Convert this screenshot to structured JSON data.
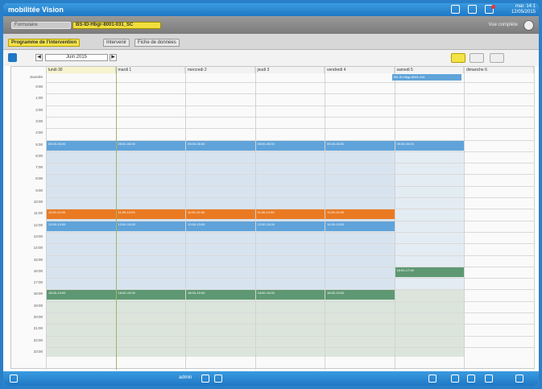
{
  "app": {
    "title": "mobilitée Vision",
    "clock_time": "mar. 14:1",
    "clock_date": "12/05/2015"
  },
  "toolbar": {
    "crumb1": "Formulaire",
    "crumb2": "BS-ID-Hbgr-8001-031_SC",
    "user": "Vue complète"
  },
  "tabs": [
    {
      "label": "Programme de l'intervention"
    },
    {
      "label": "Intervenir"
    },
    {
      "label": "Fiche de données"
    }
  ],
  "nav": {
    "date": "Juin 2015",
    "prev": "◀",
    "next": "▶"
  },
  "calendar": {
    "days": [
      "lundi 30",
      "mardi 1",
      "mercredi 2",
      "jeudi 3",
      "vendredi 4",
      "samedi 5",
      "dimanche 6"
    ],
    "allday_label": "Journée",
    "allday_event": "BS-ID-Hbgr-8001-031",
    "hours": [
      "0:00",
      "1:00",
      "2:00",
      "3:00",
      "4:00",
      "5:00",
      "6:00",
      "7:00",
      "8:00",
      "9:00",
      "10:00",
      "11:00",
      "12:00",
      "13:00",
      "14:00",
      "15:00",
      "16:00",
      "17:00",
      "18:00",
      "19:00",
      "20:00",
      "21:00",
      "22:00",
      "23:00"
    ],
    "events": [
      {
        "day": 0,
        "hour": 5,
        "color": "blue",
        "label": "05:00-06:00"
      },
      {
        "day": 1,
        "hour": 5,
        "color": "blue",
        "label": "05:00-06:00"
      },
      {
        "day": 2,
        "hour": 5,
        "color": "blue",
        "label": "05:00-06:00"
      },
      {
        "day": 3,
        "hour": 5,
        "color": "blue",
        "label": "05:00-06:00"
      },
      {
        "day": 4,
        "hour": 5,
        "color": "blue",
        "label": "05:00-06:00"
      },
      {
        "day": 5,
        "hour": 5,
        "color": "blue",
        "label": "05:00-06:00"
      },
      {
        "day": 0,
        "hour": 11,
        "color": "orange",
        "label": "11:00-12:00"
      },
      {
        "day": 1,
        "hour": 11,
        "color": "orange",
        "label": "11:00-12:00"
      },
      {
        "day": 2,
        "hour": 11,
        "color": "orange",
        "label": "11:00-12:00"
      },
      {
        "day": 3,
        "hour": 11,
        "color": "orange",
        "label": "11:00-12:00"
      },
      {
        "day": 4,
        "hour": 11,
        "color": "orange",
        "label": "11:00-12:00"
      },
      {
        "day": 0,
        "hour": 12,
        "color": "blue",
        "label": "12:00-13:00"
      },
      {
        "day": 1,
        "hour": 12,
        "color": "blue",
        "label": "12:00-13:00"
      },
      {
        "day": 2,
        "hour": 12,
        "color": "blue",
        "label": "12:00-13:00"
      },
      {
        "day": 3,
        "hour": 12,
        "color": "blue",
        "label": "12:00-13:00"
      },
      {
        "day": 4,
        "hour": 12,
        "color": "blue",
        "label": "12:00-13:00"
      },
      {
        "day": 5,
        "hour": 16,
        "color": "green",
        "label": "16:00-17:00"
      },
      {
        "day": 0,
        "hour": 18,
        "color": "green",
        "label": "18:00-19:00"
      },
      {
        "day": 1,
        "hour": 18,
        "color": "green",
        "label": "18:00-19:00"
      },
      {
        "day": 2,
        "hour": 18,
        "color": "green",
        "label": "18:00-19:00"
      },
      {
        "day": 3,
        "hour": 18,
        "color": "green",
        "label": "18:00-19:00"
      },
      {
        "day": 4,
        "hour": 18,
        "color": "green",
        "label": "18:00-19:00"
      }
    ]
  },
  "status": {
    "user": "admin"
  },
  "colors": {
    "accent": "#1f77c4",
    "blue_event": "#5fa3da",
    "orange_event": "#ea7a22",
    "green_event": "#5e9872",
    "highlight": "#f4e347"
  }
}
